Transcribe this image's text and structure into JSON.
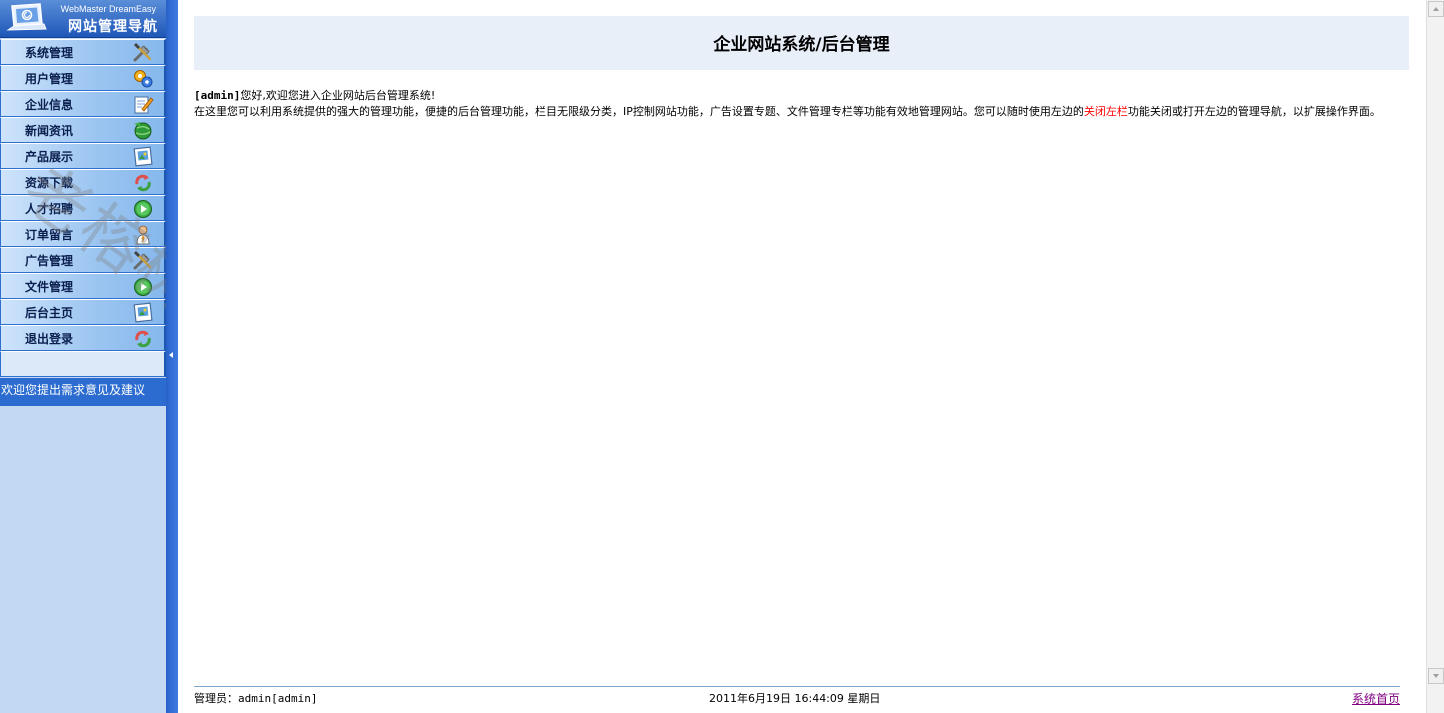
{
  "logo": {
    "subtitle": "WebMaster DreamEasy",
    "title": "网站管理导航"
  },
  "menu": {
    "items": [
      {
        "label": "系统管理",
        "icon": "tools-icon"
      },
      {
        "label": "用户管理",
        "icon": "gears-icon"
      },
      {
        "label": "企业信息",
        "icon": "edit-doc-icon"
      },
      {
        "label": "新闻资讯",
        "icon": "globe-icon"
      },
      {
        "label": "产品展示",
        "icon": "picture-icon"
      },
      {
        "label": "资源下载",
        "icon": "refresh-icon"
      },
      {
        "label": "人才招聘",
        "icon": "play-icon"
      },
      {
        "label": "订单留言",
        "icon": "user-tie-icon"
      },
      {
        "label": "广告管理",
        "icon": "tools-icon"
      },
      {
        "label": "文件管理",
        "icon": "play-icon"
      },
      {
        "label": "后台主页",
        "icon": "picture-icon"
      },
      {
        "label": "退出登录",
        "icon": "refresh-icon"
      }
    ],
    "feedback": "欢迎您提出需求意见及建议"
  },
  "watermark": "老榕树网络",
  "main": {
    "title": "企业网站系统/后台管理",
    "welcome_user": "[admin]",
    "welcome_greeting": "您好,欢迎您进入企业网站后台管理系统!",
    "welcome_body_1": "在这里您可以利用系统提供的强大的管理功能，便捷的后台管理功能，栏目无限级分类，IP控制网站功能，广告设置专题、文件管理专栏等功能有效地管理网站。您可以随时使用左边的",
    "welcome_link": "关闭左栏",
    "welcome_body_2": "功能关闭或打开左边的管理导航，以扩展操作界面。"
  },
  "footer": {
    "admin_label": "管理员：",
    "admin_value": "admin[admin]",
    "datetime": "2011年6月19日 16:44:09 星期日",
    "home_link": "系统首页"
  },
  "colors": {
    "nav_bg": "#c3d9f3",
    "nav_border": "#2f6fcf",
    "divider": "#2862c9",
    "header_band": "#e9eff9",
    "link_red": "#ff0000",
    "link_visited": "#800080"
  }
}
